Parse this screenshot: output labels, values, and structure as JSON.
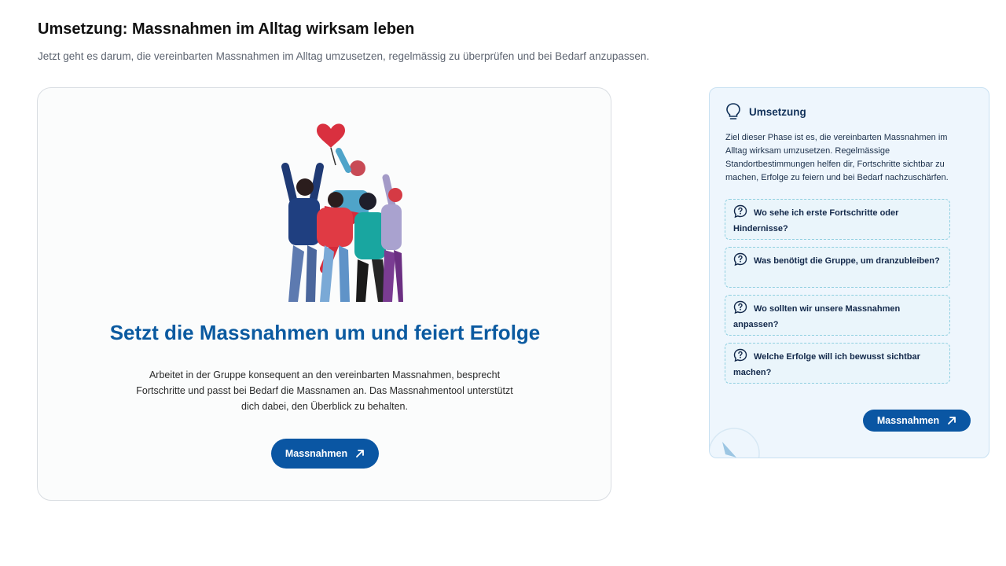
{
  "header": {
    "title": "Umsetzung: Massnahmen im Alltag wirksam leben",
    "subtitle": "Jetzt geht es darum, die vereinbarten Massnahmen im Alltag umzusetzen, regelmässig zu überprüfen und bei Bedarf anzupassen."
  },
  "main_card": {
    "heading": "Setzt die Massnahmen um und feiert Erfolge",
    "text": "Arbeitet in der Gruppe konsequent an den vereinbarten Massnahmen, besprecht Fortschritte und passt bei Bedarf die Massnamen an. Das Massnahmentool unterstützt dich dabei, den Überblick zu behalten.",
    "button_label": "Massnahmen",
    "illustration_icon": "celebrating-group-illustration"
  },
  "side_card": {
    "title": "Umsetzung",
    "title_icon": "lightbulb-icon",
    "text": "Ziel dieser Phase ist es, die vereinbarten Massnahmen im Alltag wirksam umzusetzen. Regelmässige Standortbestimmungen helfen dir, Fortschritte sichtbar zu machen, Erfolge zu feiern und bei Bedarf nachzuschärfen.",
    "questions": [
      {
        "label": "Wo sehe ich erste Fortschritte oder Hindernisse?"
      },
      {
        "label": "Was benötigt die Gruppe, um dranzubleiben?"
      },
      {
        "label": "Wo sollten wir unsere Massnahmen anpassen?"
      },
      {
        "label": "Welche Erfolge will ich bewusst sichtbar machen?"
      }
    ],
    "button_label": "Massnahmen"
  },
  "colors": {
    "accent": "#0a56a3",
    "heading_blue": "#0b5aa0",
    "side_bg": "#eef6fd",
    "question_border": "#8fcfe0"
  }
}
